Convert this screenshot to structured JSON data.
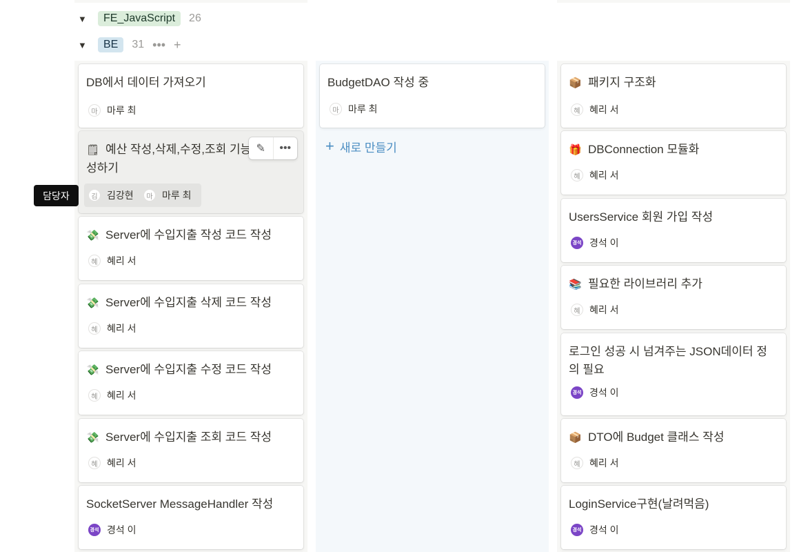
{
  "groups": [
    {
      "label": "FE_JavaScript",
      "count": "26"
    },
    {
      "label": "BE",
      "count": "31"
    }
  ],
  "group_actions": {
    "more_icon": "•••",
    "add_icon": "+"
  },
  "tooltip": "담당자",
  "new_button": {
    "icon": "+",
    "label": "새로 만들기"
  },
  "hover_tools": {
    "edit_icon": "✎",
    "more_icon": "•••"
  },
  "columns": [
    {
      "cards": [
        {
          "emoji": "",
          "title": "DB에서 데이터 가져오기",
          "people": [
            {
              "initial": "마",
              "name": "마루 최",
              "style": "plain"
            }
          ]
        },
        {
          "emoji": "🗒",
          "title": "예산 작성,삭제,수정,조회 기능 같이 작성하기",
          "people": [
            {
              "initial": "김",
              "name": "김강현",
              "style": "plain"
            },
            {
              "initial": "마",
              "name": "마루 최",
              "style": "plain"
            }
          ]
        },
        {
          "emoji": "💸",
          "title": "Server에 수입지출 작성 코드 작성",
          "people": [
            {
              "initial": "혜",
              "name": "혜리 서",
              "style": "plain"
            }
          ]
        },
        {
          "emoji": "💸",
          "title": "Server에 수입지출 삭제 코드 작성",
          "people": [
            {
              "initial": "혜",
              "name": "혜리 서",
              "style": "plain"
            }
          ]
        },
        {
          "emoji": "💸",
          "title": "Server에 수입지출 수정 코드 작성",
          "people": [
            {
              "initial": "혜",
              "name": "혜리 서",
              "style": "plain"
            }
          ]
        },
        {
          "emoji": "💸",
          "title": "Server에 수입지출 조회 코드 작성",
          "people": [
            {
              "initial": "혜",
              "name": "혜리 서",
              "style": "plain"
            }
          ]
        },
        {
          "emoji": "",
          "title": "SocketServer MessageHandler 작성",
          "people": [
            {
              "initial": "경석",
              "name": "경석 이",
              "style": "purple"
            }
          ]
        }
      ]
    },
    {
      "cards": [
        {
          "emoji": "",
          "title": "BudgetDAO 작성 중",
          "people": [
            {
              "initial": "마",
              "name": "마루 최",
              "style": "plain"
            }
          ]
        }
      ]
    },
    {
      "cards": [
        {
          "emoji": "📦",
          "title": "패키지 구조화",
          "people": [
            {
              "initial": "혜",
              "name": "혜리 서",
              "style": "plain"
            }
          ]
        },
        {
          "emoji": "🎁",
          "title": "DBConnection 모듈화",
          "people": [
            {
              "initial": "혜",
              "name": "혜리 서",
              "style": "plain"
            }
          ]
        },
        {
          "emoji": "",
          "title": "UsersService 회원 가입 작성",
          "people": [
            {
              "initial": "경석",
              "name": "경석 이",
              "style": "purple"
            }
          ]
        },
        {
          "emoji": "📚",
          "title": "필요한 라이브러리 추가",
          "people": [
            {
              "initial": "혜",
              "name": "혜리 서",
              "style": "plain"
            }
          ]
        },
        {
          "emoji": "",
          "title": "로그인 성공 시 넘겨주는 JSON데이터 정의 필요",
          "people": [
            {
              "initial": "경석",
              "name": "경석 이",
              "style": "purple"
            }
          ]
        },
        {
          "emoji": "📦",
          "title": "DTO에 Budget 클래스 작성",
          "people": [
            {
              "initial": "혜",
              "name": "혜리 서",
              "style": "plain"
            }
          ]
        },
        {
          "emoji": "",
          "title": "LoginService구현(날려먹음)",
          "people": [
            {
              "initial": "경석",
              "name": "경석 이",
              "style": "purple"
            }
          ]
        }
      ]
    }
  ]
}
